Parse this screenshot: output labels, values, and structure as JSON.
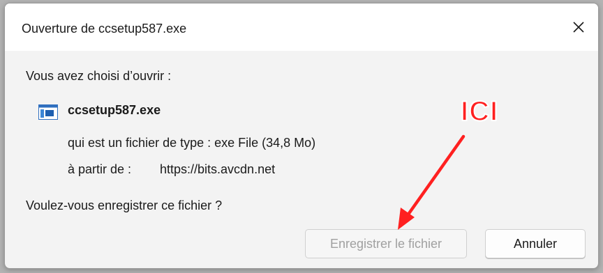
{
  "dialog": {
    "title": "Ouverture de ccsetup587.exe",
    "close_glyph": "✕",
    "intro": "Vous avez choisi d’ouvrir :",
    "file": {
      "icon": "executable-file-icon",
      "name": "ccsetup587.exe",
      "type_line": "qui est un fichier de type :  exe File (34,8 Mo)",
      "source_label": "à partir de :",
      "source_url": "https://bits.avcdn.net"
    },
    "question": "Voulez-vous enregistrer ce fichier ?",
    "buttons": {
      "save_label": "Enregistrer le fichier",
      "cancel_label": "Annuler"
    }
  },
  "annotation": {
    "label": "ICI",
    "color": "#ff2020"
  }
}
